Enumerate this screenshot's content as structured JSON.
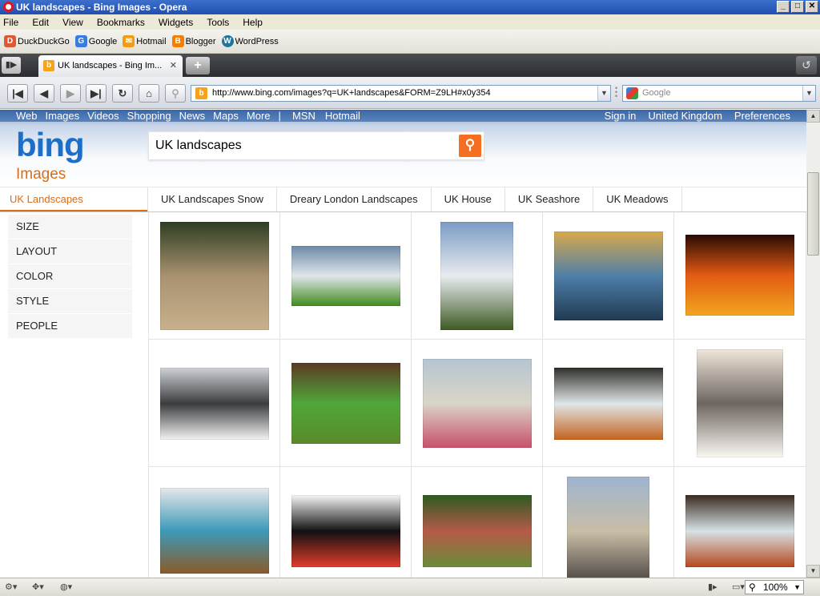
{
  "window": {
    "title": "UK landscapes - Bing Images - Opera",
    "btn_min": "_",
    "btn_max": "□",
    "btn_close": "✕"
  },
  "menu": [
    "File",
    "Edit",
    "View",
    "Bookmarks",
    "Widgets",
    "Tools",
    "Help"
  ],
  "bookmarks": [
    {
      "label": "DuckDuckGo",
      "color": "#de5833"
    },
    {
      "label": "Google",
      "color": "#3a7be0"
    },
    {
      "label": "Hotmail",
      "color": "#f39c12"
    },
    {
      "label": "Blogger",
      "color": "#f57d00"
    },
    {
      "label": "WordPress",
      "color": "#21759b"
    }
  ],
  "tab": {
    "label": "UK landscapes - Bing Im...",
    "close": "✕",
    "favicon": "b"
  },
  "address": {
    "url": "http://www.bing.com/images?q=UK+landscapes&FORM=Z9LH#x0y354"
  },
  "search_engine": {
    "placeholder": "Google"
  },
  "bing": {
    "nav_left": [
      "Web",
      "Images",
      "Videos",
      "Shopping",
      "News",
      "Maps",
      "More",
      "|",
      "MSN",
      "Hotmail"
    ],
    "nav_right": [
      "Sign in",
      "United Kingdom",
      "Preferences"
    ],
    "logo": "bing",
    "images_label": "Images",
    "query": "UK landscapes",
    "related_active": "UK Landscapes",
    "related": [
      "UK Landscapes Snow",
      "Dreary London Landscapes",
      "UK House",
      "UK Seashore",
      "UK Meadows"
    ],
    "filters": [
      "SIZE",
      "LAYOUT",
      "COLOR",
      "STYLE",
      "PEOPLE"
    ]
  },
  "images": [
    {
      "name": "garden-patio",
      "colors": [
        "#2f3d22",
        "#a89270",
        "#c8b08c"
      ]
    },
    {
      "name": "green-field-tree",
      "colors": [
        "#6c8aa8",
        "#dfe6ea",
        "#3f8a1e"
      ]
    },
    {
      "name": "village-church",
      "colors": [
        "#7a9bc4",
        "#e9ecef",
        "#3d5a24"
      ]
    },
    {
      "name": "river-painting",
      "colors": [
        "#d7a94a",
        "#4e7fa8",
        "#203a52"
      ]
    },
    {
      "name": "autumn-forest",
      "colors": [
        "#2a0a04",
        "#e35b12",
        "#f2a520"
      ]
    },
    {
      "name": "snowy-lane",
      "colors": [
        "#cfd2d6",
        "#3a3c3e",
        "#f3f3f3"
      ]
    },
    {
      "name": "lawn-fence",
      "colors": [
        "#5b3a24",
        "#4fa73a",
        "#5b8a2a"
      ]
    },
    {
      "name": "watercolour-church",
      "colors": [
        "#b5c5d1",
        "#d9d5c8",
        "#c8506a"
      ]
    },
    {
      "name": "autumn-waterfall",
      "colors": [
        "#2f2f2a",
        "#e0e6e8",
        "#c4621e"
      ]
    },
    {
      "name": "frosty-tree",
      "colors": [
        "#efe7da",
        "#6d6560",
        "#fbf8f2"
      ]
    },
    {
      "name": "poppy-art",
      "colors": [
        "#e6e8ea",
        "#3d9ab8",
        "#8a5a2a"
      ]
    },
    {
      "name": "circular-chart",
      "colors": [
        "#f7f7f7",
        "#111111",
        "#e23d2c"
      ]
    },
    {
      "name": "garden-path",
      "colors": [
        "#2e5a22",
        "#b55a48",
        "#6b8c3a"
      ]
    },
    {
      "name": "town-hall",
      "colors": [
        "#9fb4cf",
        "#c8bda6",
        "#403a38"
      ]
    },
    {
      "name": "waterfall-rocks",
      "colors": [
        "#3a2a20",
        "#d7e2e6",
        "#b5481e"
      ]
    }
  ],
  "status": {
    "zoom": "100%"
  }
}
